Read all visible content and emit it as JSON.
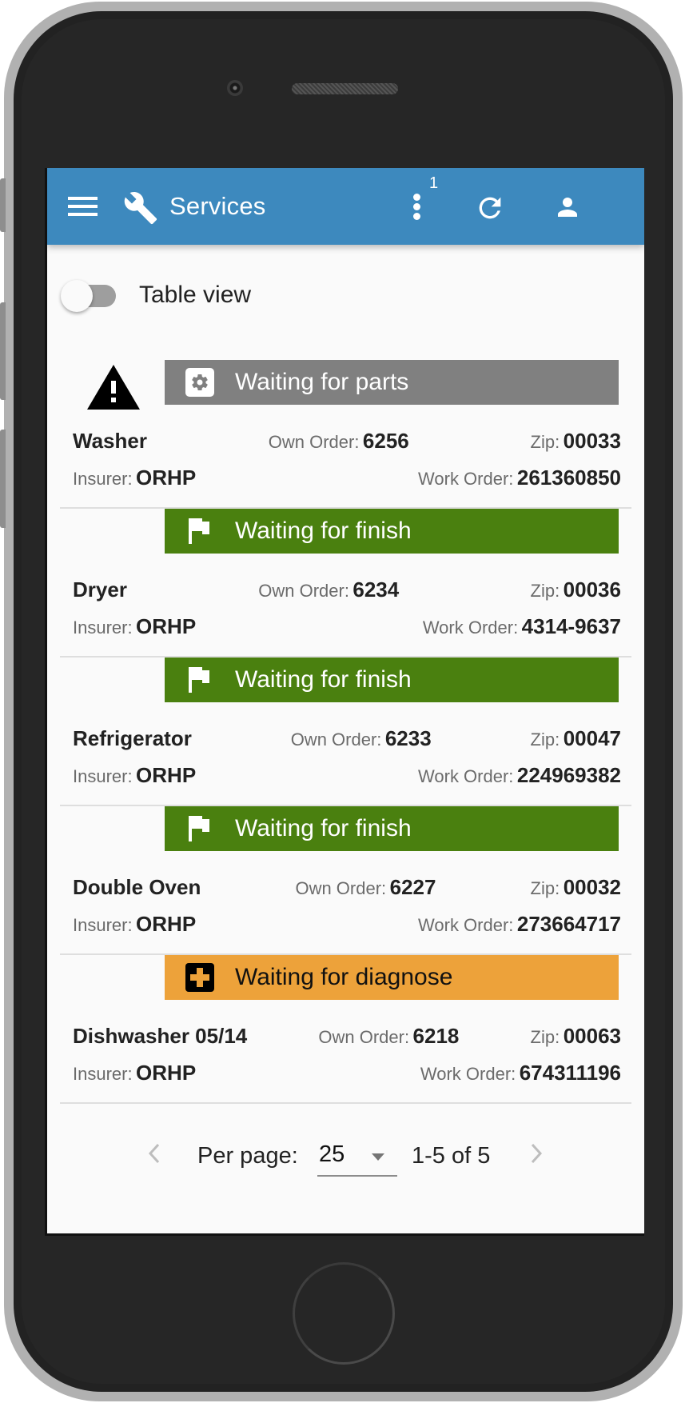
{
  "app_bar": {
    "title": "Services",
    "badge_count": "1",
    "icons": {
      "menu": "hamburger-menu-icon",
      "brand": "wrench-icon",
      "more": "more-vertical-icon",
      "refresh": "refresh-icon",
      "account": "person-icon"
    }
  },
  "view_toggle": {
    "label": "Table view",
    "checked": false
  },
  "colors": {
    "app_bar": "#3d89be",
    "status_gray": "#808080",
    "status_green": "#4a800f",
    "status_orange": "#eda23a"
  },
  "labels": {
    "own_order": "Own Order:",
    "zip": "Zip:",
    "insurer": "Insurer:",
    "work_order": "Work Order:"
  },
  "services": [
    {
      "status": "Waiting for parts",
      "status_icon": "gear-icon",
      "status_color": "#808080",
      "status_text_color": "#ffffff",
      "warning": true,
      "appliance": "Washer",
      "own_order": "6256",
      "zip": "00033",
      "insurer": "ORHP",
      "work_order": "261360850"
    },
    {
      "status": "Waiting for finish",
      "status_icon": "flag-icon",
      "status_color": "#4a800f",
      "status_text_color": "#ffffff",
      "warning": false,
      "appliance": "Dryer",
      "own_order": "6234",
      "zip": "00036",
      "insurer": "ORHP",
      "work_order": "4314-9637"
    },
    {
      "status": "Waiting for finish",
      "status_icon": "flag-icon",
      "status_color": "#4a800f",
      "status_text_color": "#ffffff",
      "warning": false,
      "appliance": "Refrigerator",
      "own_order": "6233",
      "zip": "00047",
      "insurer": "ORHP",
      "work_order": "224969382"
    },
    {
      "status": "Waiting for finish",
      "status_icon": "flag-icon",
      "status_color": "#4a800f",
      "status_text_color": "#ffffff",
      "warning": false,
      "appliance": "Double Oven",
      "own_order": "6227",
      "zip": "00032",
      "insurer": "ORHP",
      "work_order": "273664717"
    },
    {
      "status": "Waiting for diagnose",
      "status_icon": "medical-plus-icon",
      "status_color": "#eda23a",
      "status_text_color": "#111111",
      "warning": false,
      "appliance": "Dishwasher 05/14",
      "own_order": "6218",
      "zip": "00063",
      "insurer": "ORHP",
      "work_order": "674311196"
    }
  ],
  "pagination": {
    "per_page_label": "Per page:",
    "per_page_value": "25",
    "range_text": "1-5 of 5",
    "prev_enabled": false,
    "next_enabled": false
  }
}
